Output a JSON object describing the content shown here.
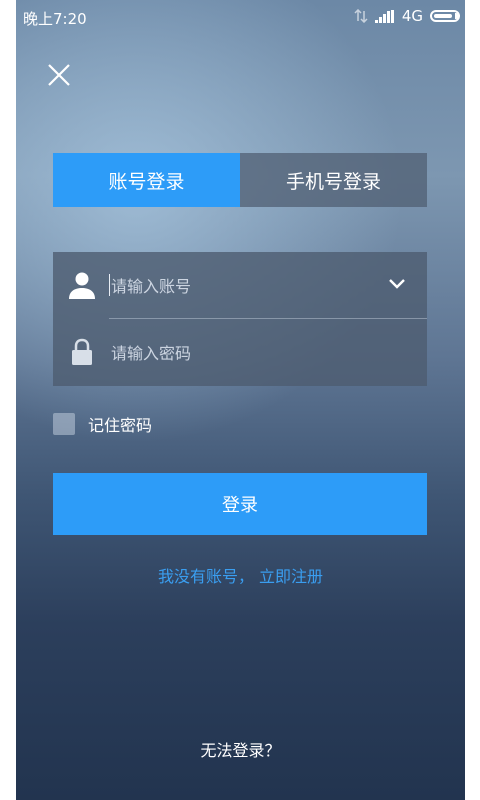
{
  "status_bar": {
    "time": "晚上7:20",
    "network": "4G"
  },
  "tabs": [
    {
      "label": "账号登录",
      "active": true
    },
    {
      "label": "手机号登录",
      "active": false
    }
  ],
  "form": {
    "account_placeholder": "请输入账号",
    "password_placeholder": "请输入密码"
  },
  "remember": {
    "label": "记住密码",
    "checked": false
  },
  "login_button": "登录",
  "register_link": "我没有账号， 立即注册",
  "cannot_login": "无法登录？",
  "colors": {
    "accent": "#2d9cf8",
    "link": "#3a9ef0"
  },
  "icons": [
    "close-icon",
    "user-icon",
    "lock-icon",
    "chevron-down-icon",
    "signal-icon",
    "battery-icon"
  ]
}
